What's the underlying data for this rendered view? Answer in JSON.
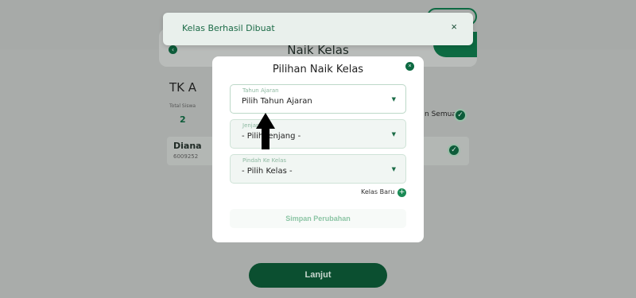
{
  "background": {
    "header_title": "Naik Kelas",
    "class_name": "TK A",
    "total_label": "Total Siswa",
    "total_value": "2",
    "select_all_label": "n Semua",
    "student": {
      "name": "Diana",
      "id": "6009252"
    },
    "continue_label": "Lanjut"
  },
  "toast": {
    "message": "Kelas Berhasil Dibuat",
    "close_symbol": "×"
  },
  "modal": {
    "title": "Pilihan Naik Kelas",
    "close_symbol": "×",
    "fields": [
      {
        "label": "Tahun Ajaran",
        "value": "Pilih Tahun Ajaran"
      },
      {
        "label": "Jenjang",
        "value": "- Pilih Jenjang -"
      },
      {
        "label": "Pindah Ke Kelas",
        "value": "- Pilih Kelas -"
      }
    ],
    "new_class_label": "Kelas Baru",
    "new_class_symbol": "+",
    "save_label": "Simpan Perubahan"
  },
  "icons": {
    "caret": "▼",
    "check": "✓",
    "back": "‹"
  },
  "colors": {
    "brand_green": "#0d6a42",
    "toast_text": "#1c6b47",
    "overlay": "#a9acaa"
  }
}
